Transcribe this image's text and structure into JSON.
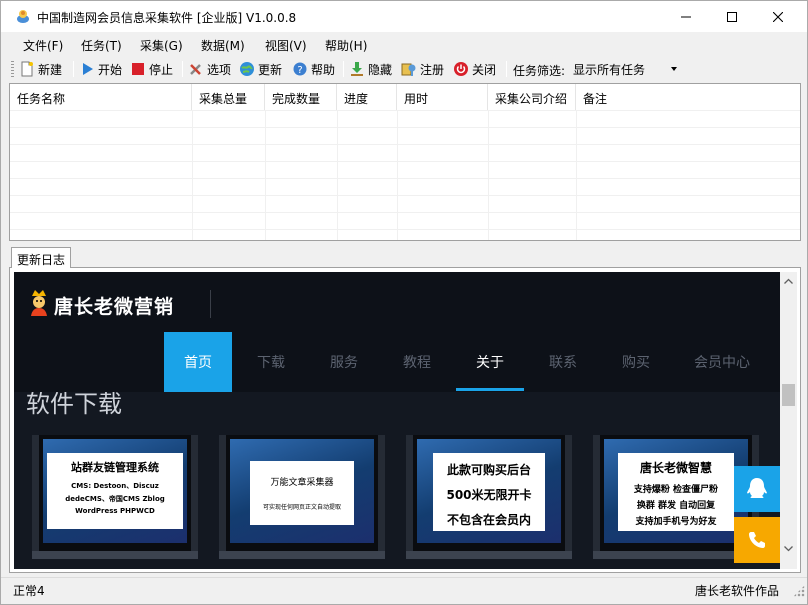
{
  "window": {
    "title": "中国制造网会员信息采集软件 [企业版] V1.0.0.8"
  },
  "menu": [
    "文件(F)",
    "任务(T)",
    "采集(G)",
    "数据(M)",
    "视图(V)",
    "帮助(H)"
  ],
  "toolbar": {
    "new": "新建",
    "start": "开始",
    "stop": "停止",
    "options": "选项",
    "update": "更新",
    "help": "帮助",
    "hide": "隐藏",
    "register": "注册",
    "close": "关闭",
    "filter_label": "任务筛选:",
    "filter_value": "显示所有任务"
  },
  "table": {
    "columns": [
      "任务名称",
      "采集总量",
      "完成数量",
      "进度",
      "用时",
      "采集公司介绍",
      "备注"
    ],
    "rows": []
  },
  "tabs": [
    "更新日志"
  ],
  "site": {
    "logo": "唐长老微营销",
    "nav": [
      "首页",
      "下载",
      "服务",
      "教程",
      "关于",
      "联系",
      "购买",
      "会员中心"
    ],
    "section_heading": "软件下载",
    "cards": [
      {
        "lines": [
          "站群友链管理系统",
          "CMS: Destoon、Discuz",
          "dedeCMS、帝国CMS Zblog",
          "WordPress PHPWCD"
        ]
      },
      {
        "lines": [
          "万能文章采集器",
          "可实现任何网页正文自动提取"
        ]
      },
      {
        "lines": [
          "此款可购买后台",
          "500米无限开卡",
          "不包含在会员内"
        ]
      },
      {
        "lines": [
          "唐长老微智慧",
          "支持爆粉 检查僵尸粉",
          "换群 群发 自动回复",
          "支持加手机号为好友"
        ]
      }
    ]
  },
  "status": {
    "left": "正常4",
    "right": "唐长老软件作品"
  },
  "colors": {
    "accent": "#1aa3e8",
    "phone": "#f7a800",
    "site_bg": "#131821"
  }
}
